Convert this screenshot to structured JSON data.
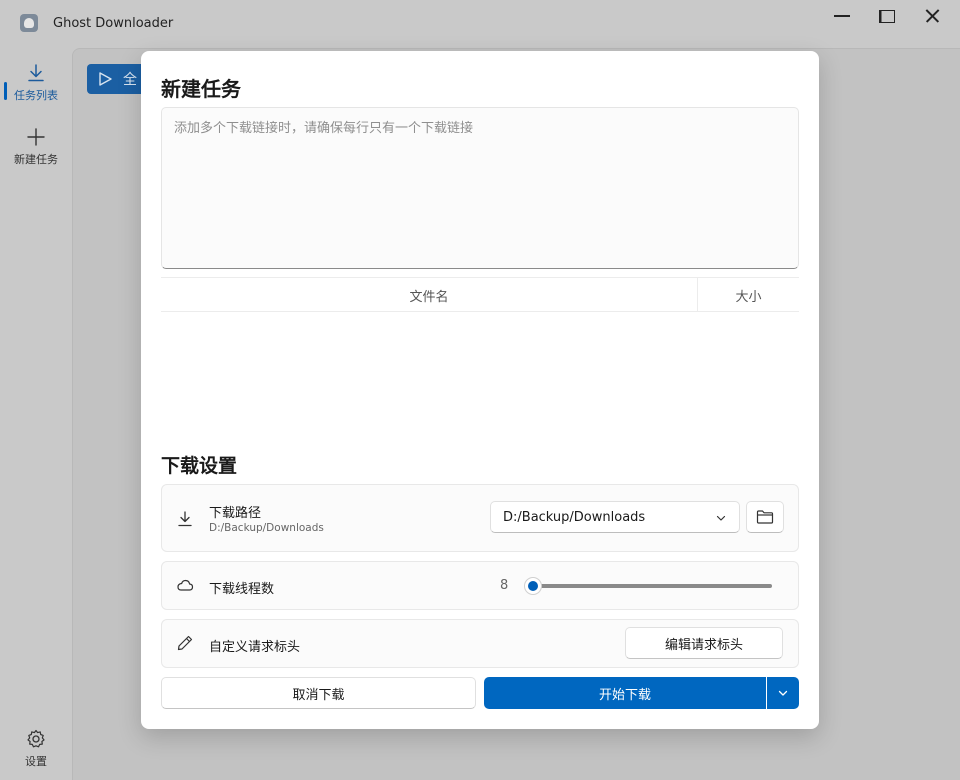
{
  "window": {
    "title": "Ghost Downloader"
  },
  "sidebar": {
    "items": [
      {
        "label": "任务列表",
        "icon": "download-icon",
        "active": true
      },
      {
        "label": "新建任务",
        "icon": "plus-icon",
        "active": false
      }
    ],
    "settings_label": "设置"
  },
  "background": {
    "start_all_label": "全"
  },
  "dialog": {
    "title": "新建任务",
    "url_input": {
      "placeholder": "添加多个下载链接时，请确保每行只有一个下载链接",
      "value": ""
    },
    "file_table": {
      "columns": [
        "文件名",
        "大小"
      ],
      "rows": []
    },
    "settings_title": "下载设置",
    "download_path": {
      "label": "下载路径",
      "current": "D:/Backup/Downloads",
      "selected": "D:/Backup/Downloads"
    },
    "threads": {
      "label": "下载线程数",
      "value": "8",
      "min": 1,
      "max": 256
    },
    "headers": {
      "label": "自定义请求标头",
      "button_label": "编辑请求标头"
    },
    "cancel_label": "取消下载",
    "start_label": "开始下载"
  },
  "colors": {
    "accent": "#0067c0",
    "overlay": "#c9c9c9"
  }
}
